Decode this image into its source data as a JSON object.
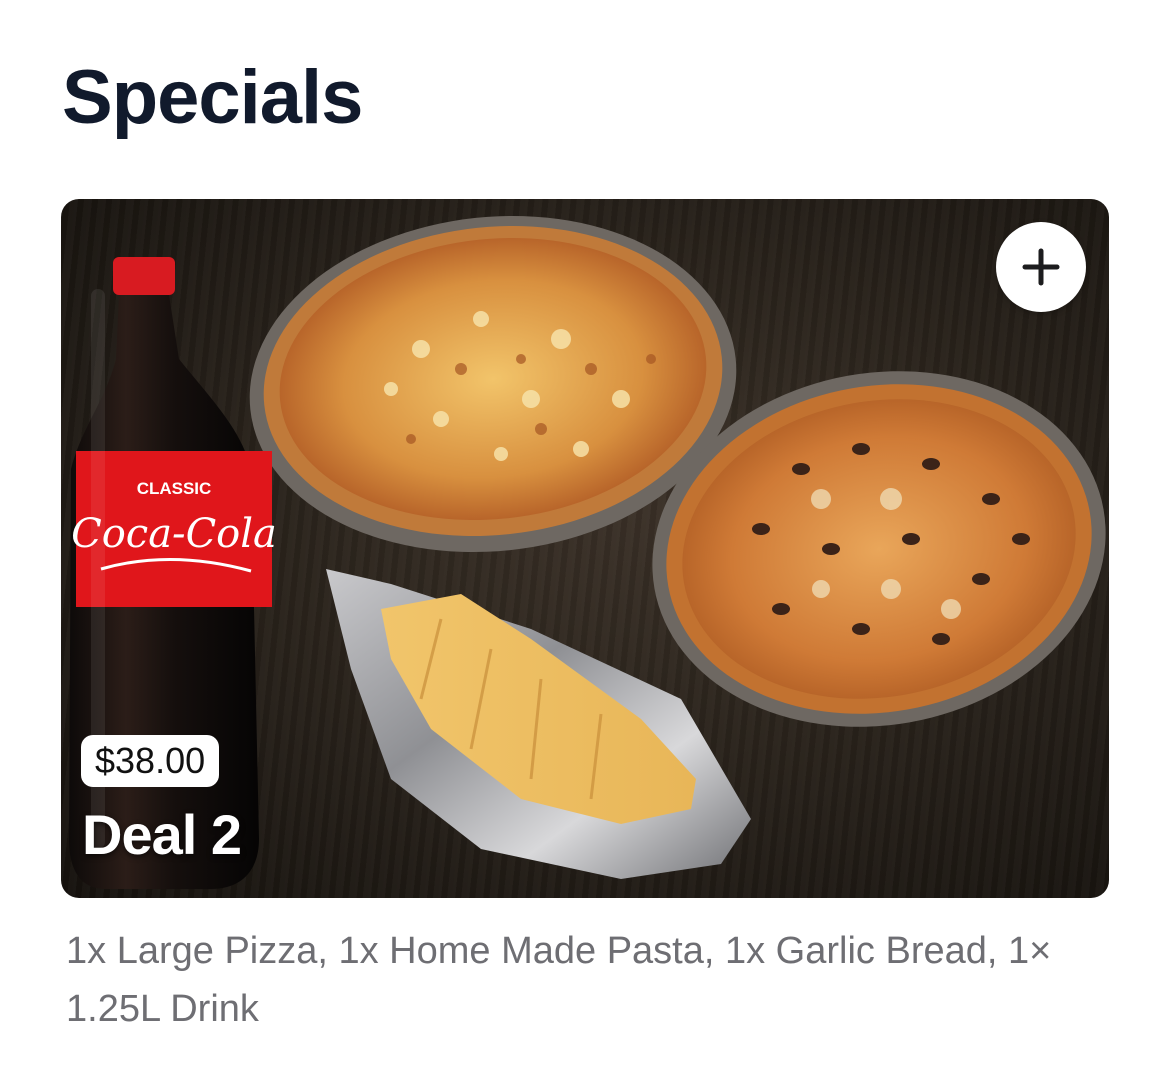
{
  "section": {
    "title": "Specials"
  },
  "card": {
    "price": "$38.00",
    "name": "Deal 2",
    "description": "1x Large Pizza, 1x Home Made Pasta, 1x Garlic Bread, 1× 1.25L Drink",
    "add_icon": "plus-icon",
    "image_subject": "coca-cola bottle, two pizzas, garlic bread in foil"
  },
  "label_art": {
    "line1": "CLASSIC",
    "line2": "Coca-Cola"
  },
  "colors": {
    "title": "#111a2c",
    "description": "#6e6e73",
    "badge_bg": "#ffffff",
    "cola_red": "#e0161b"
  }
}
